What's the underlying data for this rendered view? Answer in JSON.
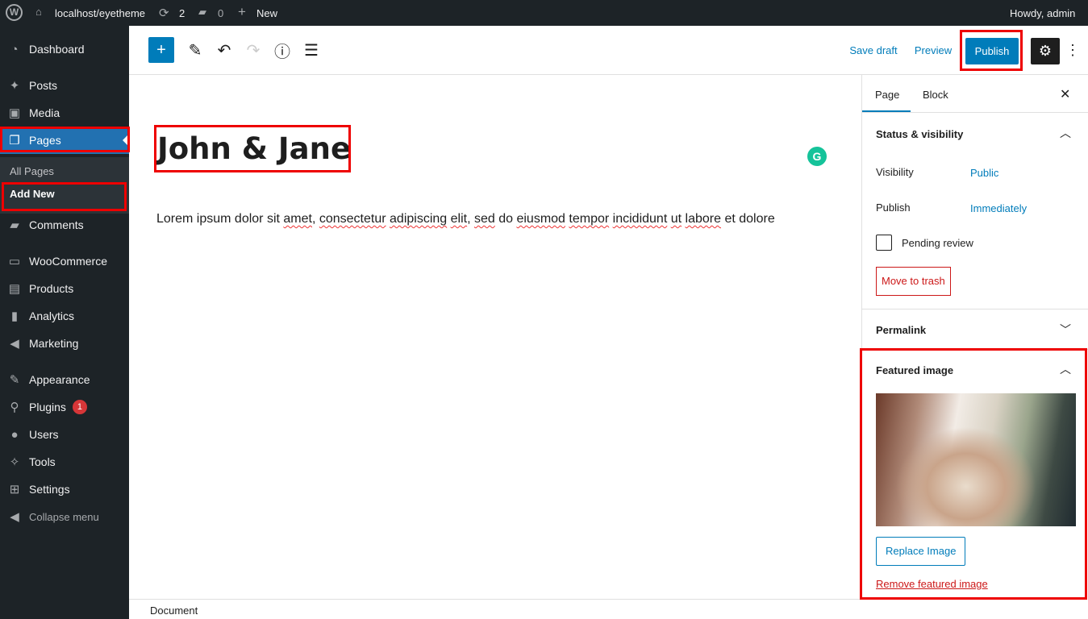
{
  "adminbar": {
    "site": "localhost/eyetheme",
    "updates": "2",
    "comments": "0",
    "new": "New",
    "howdy": "Howdy, admin"
  },
  "sidebar": {
    "items": [
      {
        "label": "Dashboard",
        "icon": "dashboard-icon"
      },
      {
        "label": "Posts",
        "icon": "pin-icon"
      },
      {
        "label": "Media",
        "icon": "media-icon"
      },
      {
        "label": "Pages",
        "icon": "pages-icon",
        "active": true
      },
      {
        "label": "Comments",
        "icon": "comment-icon"
      },
      {
        "label": "WooCommerce",
        "icon": "woo-icon"
      },
      {
        "label": "Products",
        "icon": "archive-icon"
      },
      {
        "label": "Analytics",
        "icon": "bar-chart-icon"
      },
      {
        "label": "Marketing",
        "icon": "megaphone-icon"
      },
      {
        "label": "Appearance",
        "icon": "brush-icon"
      },
      {
        "label": "Plugins",
        "icon": "plugin-icon",
        "badge": "1"
      },
      {
        "label": "Users",
        "icon": "user-icon"
      },
      {
        "label": "Tools",
        "icon": "wrench-icon"
      },
      {
        "label": "Settings",
        "icon": "sliders-icon"
      },
      {
        "label": "Collapse menu",
        "icon": "collapse-icon"
      }
    ],
    "submenu": [
      "All Pages",
      "Add New"
    ]
  },
  "toolbar": {
    "save_draft": "Save draft",
    "preview": "Preview",
    "publish": "Publish"
  },
  "editor": {
    "title": "John & Jane",
    "paragraph": [
      "Lorem ipsum dolor sit ",
      "amet",
      ", ",
      "consectetur",
      " ",
      "adipiscing",
      " ",
      "elit",
      ", ",
      "sed",
      " do ",
      "eiusmod",
      " ",
      "tempor",
      " ",
      "incididunt",
      " ",
      "ut",
      " ",
      "labore",
      " et dolore"
    ]
  },
  "panel": {
    "tabs": [
      "Page",
      "Block"
    ],
    "status_title": "Status & visibility",
    "visibility_label": "Visibility",
    "visibility_value": "Public",
    "publish_label": "Publish",
    "publish_value": "Immediately",
    "pending": "Pending review",
    "trash": "Move to trash",
    "permalink": "Permalink",
    "featured": "Featured image",
    "replace": "Replace Image",
    "remove": "Remove featured image"
  },
  "footer": {
    "breadcrumb": "Document"
  },
  "colors": {
    "accent": "#007cba",
    "highlight": "#e00000",
    "admin_bg": "#1d2327"
  }
}
